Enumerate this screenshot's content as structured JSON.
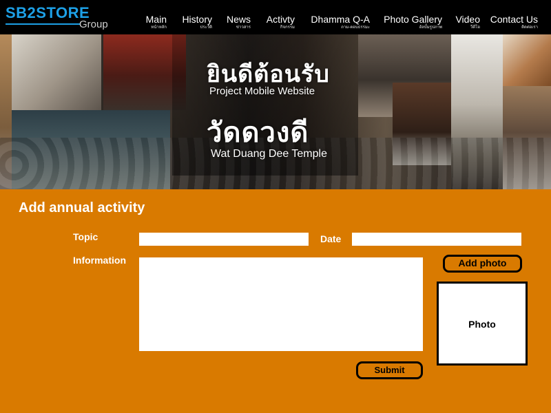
{
  "header": {
    "logo_main": "SB2STORE",
    "logo_sub": "Group",
    "brand_color": "#1da0e6",
    "nav": [
      {
        "en": "Main",
        "th": "หน้าหลัก"
      },
      {
        "en": "History",
        "th": "ประวัติ"
      },
      {
        "en": "News",
        "th": "ข่าวสาร"
      },
      {
        "en": "Activty",
        "th": "กิจกรรม"
      },
      {
        "en": "Dhamma Q-A",
        "th": "ถาม-ตอบธรรมะ"
      },
      {
        "en": "Photo Gallery",
        "th": "อัลบั้มรูปภาพ"
      },
      {
        "en": "Video",
        "th": "วีดีโอ"
      },
      {
        "en": "Contact Us",
        "th": "ติดต่อเรา"
      }
    ]
  },
  "banner": {
    "welcome_th": "ยินดีต้อนรับ",
    "welcome_en": "Project Mobile Website",
    "temple_th": "วัดดวงดี",
    "temple_en": "Wat Duang Dee Temple"
  },
  "form": {
    "title": "Add annual activity",
    "topic_label": "Topic",
    "topic_value": "",
    "date_label": "Date",
    "date_value": "",
    "info_label": "Information",
    "info_value": "",
    "add_photo_label": "Add photo",
    "photo_placeholder": "Photo",
    "submit_label": "Submit",
    "background_color": "#d97a00"
  }
}
